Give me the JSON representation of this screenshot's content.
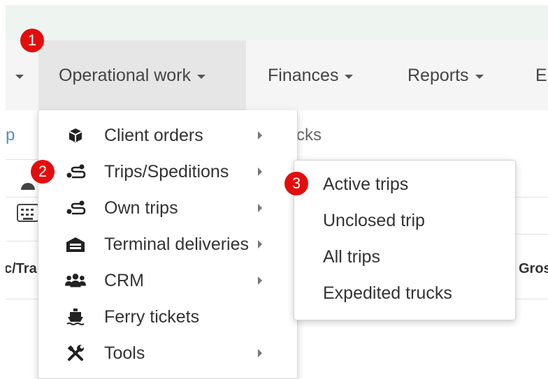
{
  "navbar": {
    "items": [
      {
        "label": "Operational work",
        "active": true
      },
      {
        "label": "Finances"
      },
      {
        "label": "Reports"
      },
      {
        "label": "E"
      }
    ]
  },
  "background": {
    "tab_fragment_left": "p",
    "tab_fragment_right": "cks",
    "col_fragment_left": "c/Tra",
    "col_fragment_right": "Gros"
  },
  "dropdown": {
    "items": [
      {
        "label": "Client orders",
        "icon": "box-icon",
        "submenu": true
      },
      {
        "label": "Trips/Speditions",
        "icon": "route-icon",
        "submenu": true
      },
      {
        "label": "Own trips",
        "icon": "route-icon",
        "submenu": true
      },
      {
        "label": "Terminal deliveries",
        "icon": "warehouse-icon",
        "submenu": true
      },
      {
        "label": "CRM",
        "icon": "users-icon",
        "submenu": true
      },
      {
        "label": "Ferry tickets",
        "icon": "ship-icon",
        "submenu": false
      },
      {
        "label": "Tools",
        "icon": "tools-icon",
        "submenu": true
      }
    ]
  },
  "submenu": {
    "items": [
      {
        "label": "Active trips"
      },
      {
        "label": "Unclosed trip"
      },
      {
        "label": "All trips"
      },
      {
        "label": "Expedited trucks"
      }
    ]
  },
  "badges": [
    "1",
    "2",
    "3"
  ],
  "colors": {
    "badge": "#e40d0d",
    "navbar_bg": "#f5f5f5",
    "active_nav_bg": "#e6e6e6",
    "top_strip": "#eef5f1"
  }
}
